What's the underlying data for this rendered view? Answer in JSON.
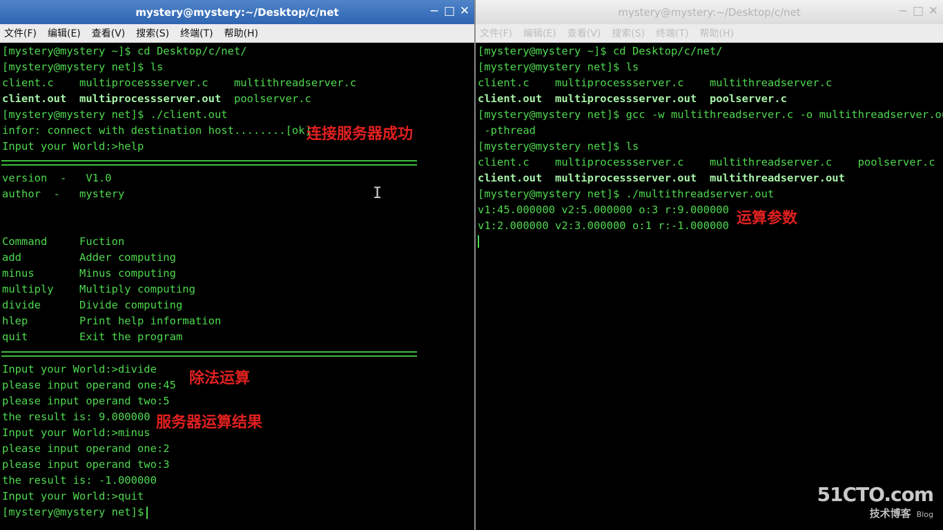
{
  "left_window": {
    "title": "mystery@mystery:~/Desktop/c/net",
    "buttons": {
      "minimize": "−",
      "maximize": "□",
      "close": "✕"
    },
    "menu": [
      "文件(F)",
      "编辑(E)",
      "查看(V)",
      "搜索(S)",
      "终端(T)",
      "帮助(H)"
    ],
    "lines": [
      "[mystery@mystery ~]$ cd Desktop/c/net/",
      "[mystery@mystery net]$ ls",
      "client.c    multiprocessserver.c    multithreadserver.c",
      "",
      "[mystery@mystery net]$ ./client.out",
      "infor: connect with destination host........[ok]",
      "Input your World:>help",
      "version  -   V1.0",
      "author  -   mystery",
      "Command     Fuction",
      "add         Adder computing",
      "minus       Minus computing",
      "multiply    Multiply computing",
      "divide      Divide computing",
      "hlep        Print help information",
      "quit        Exit the program",
      "Input your World:>divide",
      "please input operand one:45",
      "please input operand two:5",
      "the result is: 9.000000",
      "Input your World:>minus",
      "please input operand one:2",
      "please input operand two:3",
      "the result is: -1.000000",
      "Input your World:>quit",
      "[mystery@mystery net]$ "
    ],
    "bold_row": {
      "a": "client.out",
      "b": "multiprocessserver.out",
      "c": "poolserver.c"
    },
    "annotations": {
      "connect_ok": "连接服务器成功",
      "division": "除法运算",
      "server_result": "服务器运算结果"
    }
  },
  "right_window": {
    "title": "mystery@mystery:~/Desktop/c/net",
    "buttons": {
      "minimize": "−",
      "maximize": "□",
      "close": "✕"
    },
    "menu": [
      "文件(F)",
      "编辑(E)",
      "查看(V)",
      "搜索(S)",
      "终端(T)",
      "帮助(H)"
    ],
    "lines": [
      "[mystery@mystery ~]$ cd Desktop/c/net/",
      "[mystery@mystery net]$ ls",
      "client.c    multiprocessserver.c    multithreadserver.c",
      "",
      "client.out  multiprocessserver.out  poolserver.c",
      "[mystery@mystery net]$ gcc -w multithreadserver.c -o multithreadserver.out",
      " -pthread",
      "[mystery@mystery net]$ ls",
      "client.c    multiprocessserver.c    multithreadserver.c    poolserver.c",
      "",
      "[mystery@mystery net]$ ./multithreadserver.out",
      "v1:45.000000 v2:5.000000 o:3 r:9.000000",
      "v1:2.000000 v2:3.000000 o:1 r:-1.000000"
    ],
    "bold_row": {
      "a": "client.out",
      "b": "multiprocessserver.out",
      "c": "multithreadserver.out"
    },
    "annotations": {
      "params": "运算参数"
    }
  },
  "watermark": {
    "main": "51CTO.com",
    "sub": "技术博客",
    "tag": "Blog"
  },
  "colors": {
    "terminal_bg": "#000000",
    "terminal_fg": "#4fd94f",
    "annotation": "#e02020",
    "active_title": "#2f66b2"
  }
}
